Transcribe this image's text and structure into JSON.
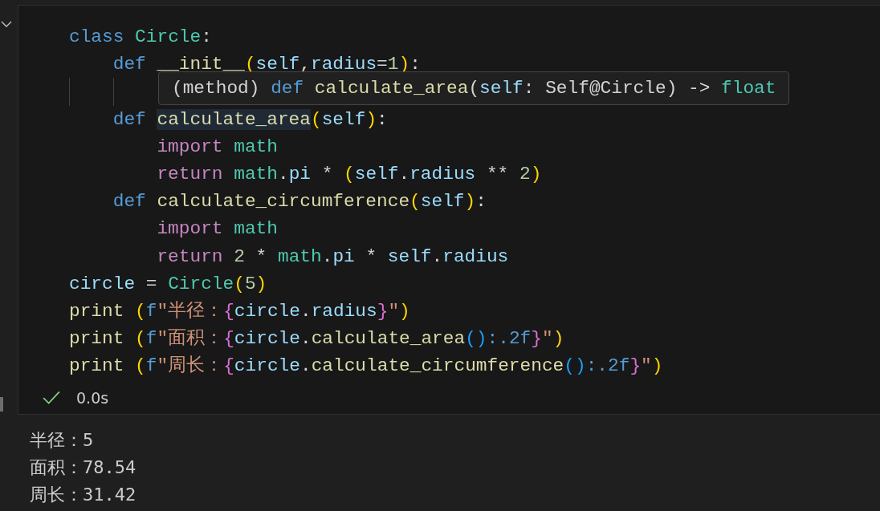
{
  "code_lines": [
    {
      "kind": "code",
      "tokens": [
        {
          "text": "class",
          "kind": "keyword"
        },
        {
          "text": " Circle",
          "kind": "type"
        },
        {
          "text": ":",
          "kind": "plain"
        }
      ]
    },
    {
      "kind": "code",
      "tokens": [
        {
          "text": "    def",
          "kind": "keyword"
        },
        {
          "text": " __init__",
          "kind": "function"
        },
        {
          "text": "(",
          "kind": "bracket1"
        },
        {
          "text": "self",
          "kind": "variable"
        },
        {
          "text": ",",
          "kind": "plain"
        },
        {
          "text": "radius",
          "kind": "variable"
        },
        {
          "text": "=",
          "kind": "plain"
        },
        {
          "text": "1",
          "kind": "number"
        },
        {
          "text": ")",
          "kind": "bracket1"
        },
        {
          "text": ":",
          "kind": "plain"
        }
      ]
    },
    {
      "kind": "hover_tooltip",
      "tokens": [
        {
          "text": "(method) ",
          "kind": "plain"
        },
        {
          "text": "def",
          "kind": "keyword"
        },
        {
          "text": " calculate_area",
          "kind": "function"
        },
        {
          "text": "(",
          "kind": "plain"
        },
        {
          "text": "self",
          "kind": "variable"
        },
        {
          "text": ": Self@Circle) -> ",
          "kind": "plain"
        },
        {
          "text": "float",
          "kind": "type"
        }
      ]
    },
    {
      "kind": "code",
      "tokens": [
        {
          "text": "    def ",
          "kind": "keyword"
        },
        {
          "text": "calculate_area",
          "kind": "function",
          "highlighted": true
        },
        {
          "text": "(",
          "kind": "bracket1"
        },
        {
          "text": "self",
          "kind": "variable"
        },
        {
          "text": ")",
          "kind": "bracket1"
        },
        {
          "text": ":",
          "kind": "plain"
        }
      ]
    },
    {
      "kind": "code",
      "tokens": [
        {
          "text": "        import",
          "kind": "control"
        },
        {
          "text": " math",
          "kind": "type"
        }
      ]
    },
    {
      "kind": "code",
      "tokens": [
        {
          "text": "        return",
          "kind": "control"
        },
        {
          "text": " math",
          "kind": "type"
        },
        {
          "text": ".",
          "kind": "plain"
        },
        {
          "text": "pi",
          "kind": "variable"
        },
        {
          "text": " * ",
          "kind": "plain"
        },
        {
          "text": "(",
          "kind": "bracket1"
        },
        {
          "text": "self",
          "kind": "variable"
        },
        {
          "text": ".",
          "kind": "plain"
        },
        {
          "text": "radius",
          "kind": "variable"
        },
        {
          "text": " ** ",
          "kind": "plain"
        },
        {
          "text": "2",
          "kind": "number"
        },
        {
          "text": ")",
          "kind": "bracket1"
        }
      ]
    },
    {
      "kind": "code",
      "tokens": [
        {
          "text": "    def",
          "kind": "keyword"
        },
        {
          "text": " calculate_circumference",
          "kind": "function"
        },
        {
          "text": "(",
          "kind": "bracket1"
        },
        {
          "text": "self",
          "kind": "variable"
        },
        {
          "text": ")",
          "kind": "bracket1"
        },
        {
          "text": ":",
          "kind": "plain"
        }
      ]
    },
    {
      "kind": "code",
      "tokens": [
        {
          "text": "        import",
          "kind": "control"
        },
        {
          "text": " math",
          "kind": "type"
        }
      ]
    },
    {
      "kind": "code",
      "tokens": [
        {
          "text": "        return",
          "kind": "control"
        },
        {
          "text": " 2",
          "kind": "number"
        },
        {
          "text": " * ",
          "kind": "plain"
        },
        {
          "text": "math",
          "kind": "type"
        },
        {
          "text": ".",
          "kind": "plain"
        },
        {
          "text": "pi",
          "kind": "variable"
        },
        {
          "text": " * ",
          "kind": "plain"
        },
        {
          "text": "self",
          "kind": "variable"
        },
        {
          "text": ".",
          "kind": "plain"
        },
        {
          "text": "radius",
          "kind": "variable"
        }
      ]
    },
    {
      "kind": "code",
      "tokens": [
        {
          "text": "circle",
          "kind": "variable"
        },
        {
          "text": " = ",
          "kind": "plain"
        },
        {
          "text": "Circle",
          "kind": "type"
        },
        {
          "text": "(",
          "kind": "bracket1"
        },
        {
          "text": "5",
          "kind": "number"
        },
        {
          "text": ")",
          "kind": "bracket1"
        }
      ]
    },
    {
      "kind": "code",
      "tokens": [
        {
          "text": "print",
          "kind": "function"
        },
        {
          "text": " (",
          "kind": "bracket1"
        },
        {
          "text": "f",
          "kind": "keyword"
        },
        {
          "text": "\"半径：",
          "kind": "string"
        },
        {
          "text": "{",
          "kind": "bracket2"
        },
        {
          "text": "circle",
          "kind": "variable"
        },
        {
          "text": ".",
          "kind": "plain"
        },
        {
          "text": "radius",
          "kind": "variable"
        },
        {
          "text": "}",
          "kind": "bracket2"
        },
        {
          "text": "\"",
          "kind": "string"
        },
        {
          "text": ")",
          "kind": "bracket1"
        }
      ]
    },
    {
      "kind": "code",
      "tokens": [
        {
          "text": "print",
          "kind": "function"
        },
        {
          "text": " (",
          "kind": "bracket1"
        },
        {
          "text": "f",
          "kind": "keyword"
        },
        {
          "text": "\"面积：",
          "kind": "string"
        },
        {
          "text": "{",
          "kind": "bracket2"
        },
        {
          "text": "circle",
          "kind": "variable"
        },
        {
          "text": ".",
          "kind": "plain"
        },
        {
          "text": "calculate_area",
          "kind": "function"
        },
        {
          "text": "()",
          "kind": "bracket3"
        },
        {
          "text": ":.2f",
          "kind": "keyword"
        },
        {
          "text": "}",
          "kind": "bracket2"
        },
        {
          "text": "\"",
          "kind": "string"
        },
        {
          "text": ")",
          "kind": "bracket1"
        }
      ]
    },
    {
      "kind": "code",
      "tokens": [
        {
          "text": "print",
          "kind": "function"
        },
        {
          "text": " (",
          "kind": "bracket1"
        },
        {
          "text": "f",
          "kind": "keyword"
        },
        {
          "text": "\"周长：",
          "kind": "string"
        },
        {
          "text": "{",
          "kind": "bracket2"
        },
        {
          "text": "circle",
          "kind": "variable"
        },
        {
          "text": ".",
          "kind": "plain"
        },
        {
          "text": "calculate_circumference",
          "kind": "function"
        },
        {
          "text": "()",
          "kind": "bracket3"
        },
        {
          "text": ":.2f",
          "kind": "keyword"
        },
        {
          "text": "}",
          "kind": "bracket2"
        },
        {
          "text": "\"",
          "kind": "string"
        },
        {
          "text": ")",
          "kind": "bracket1"
        }
      ]
    }
  ],
  "run_status": {
    "success": true,
    "duration": "0.0s"
  },
  "output_lines": [
    "半径：5",
    "面积：78.54",
    "周长：31.42"
  ]
}
